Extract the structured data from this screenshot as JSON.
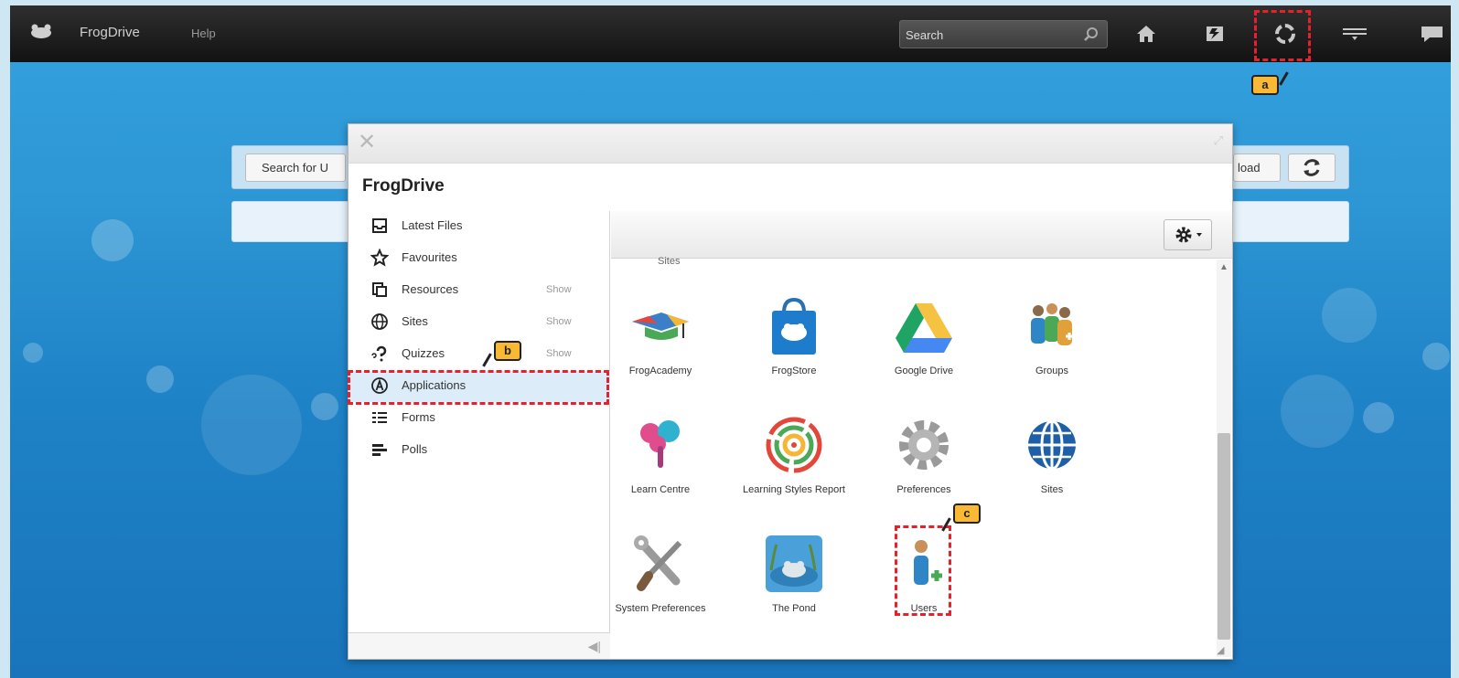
{
  "topbar": {
    "app_title": "FrogDrive",
    "help_label": "Help",
    "search_placeholder": "Search",
    "icons": [
      "frog-logo-icon",
      "home-icon",
      "frogstore-icon",
      "applications-icon",
      "people-icon",
      "chat-icon"
    ]
  },
  "annotations": {
    "a": "a",
    "b": "b",
    "c": "c"
  },
  "background_page": {
    "search_button_partial": "Search for U",
    "upload_button_partial": "load"
  },
  "dialog": {
    "title": "FrogDrive",
    "sidebar": [
      {
        "label": "Latest Files",
        "icon": "inbox-icon",
        "show": ""
      },
      {
        "label": "Favourites",
        "icon": "star-icon",
        "show": ""
      },
      {
        "label": "Resources",
        "icon": "resources-icon",
        "show": "Show"
      },
      {
        "label": "Sites",
        "icon": "globe-icon",
        "show": "Show"
      },
      {
        "label": "Quizzes",
        "icon": "quiz-icon",
        "show": "Show"
      },
      {
        "label": "Applications",
        "icon": "applications-icon",
        "show": ""
      },
      {
        "label": "Forms",
        "icon": "forms-icon",
        "show": ""
      },
      {
        "label": "Polls",
        "icon": "polls-icon",
        "show": ""
      }
    ],
    "active_item": "Applications",
    "content": {
      "section_label": "Sites",
      "apps": [
        {
          "label": "FrogAcademy",
          "icon": "graduation-cap-icon"
        },
        {
          "label": "FrogStore",
          "icon": "store-bag-icon"
        },
        {
          "label": "Google Drive",
          "icon": "google-drive-icon"
        },
        {
          "label": "Groups",
          "icon": "groups-icon"
        },
        {
          "label": "Learn Centre",
          "icon": "learn-tree-icon"
        },
        {
          "label": "Learning Styles Report",
          "icon": "target-icon"
        },
        {
          "label": "Preferences",
          "icon": "gear-icon"
        },
        {
          "label": "Sites",
          "icon": "globe-icon"
        },
        {
          "label": "System Preferences",
          "icon": "tools-icon"
        },
        {
          "label": "The Pond",
          "icon": "pond-icon"
        },
        {
          "label": "Users",
          "icon": "add-user-icon"
        }
      ]
    }
  },
  "colors": {
    "highlight": "#e8202a",
    "tag": "#f9b934",
    "topbar": "#1a1a1a",
    "background": "#2d96d4"
  }
}
